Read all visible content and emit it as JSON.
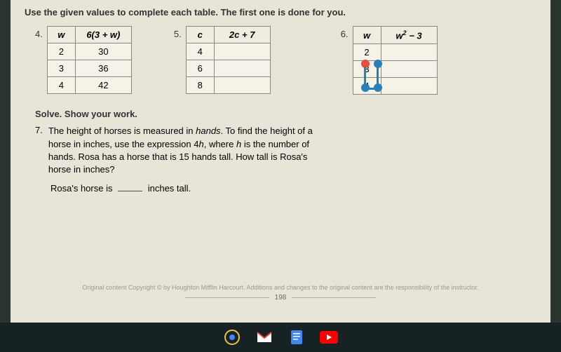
{
  "instruction": "Use the given values to complete each table. The first one is done for you.",
  "tables": [
    {
      "num": "4.",
      "col1_header": "w",
      "col2_header": "6(3 + w)",
      "rows": [
        {
          "c1": "2",
          "c2": "30"
        },
        {
          "c1": "3",
          "c2": "36"
        },
        {
          "c1": "4",
          "c2": "42"
        }
      ]
    },
    {
      "num": "5.",
      "col1_header": "c",
      "col2_header": "2c + 7",
      "rows": [
        {
          "c1": "4",
          "c2": ""
        },
        {
          "c1": "6",
          "c2": ""
        },
        {
          "c1": "8",
          "c2": ""
        }
      ]
    },
    {
      "num": "6.",
      "col1_header": "w",
      "col2_header_html": "w² − 3",
      "rows": [
        {
          "c1": "2",
          "c2": ""
        },
        {
          "c1": "3",
          "c2": ""
        },
        {
          "c1": "4",
          "c2": ""
        }
      ]
    }
  ],
  "solve_header": "Solve. Show your work.",
  "problem7": {
    "num": "7.",
    "text_parts": {
      "p1": "The height of horses is measured in ",
      "italic1": "hands",
      "p2": ". To find the height of a horse in inches, use the expression 4",
      "italic2": "h",
      "p3": ", where ",
      "italic3": "h",
      "p4": " is the number of hands. Rosa has a horse that is 15 hands tall. How tall is Rosa's horse in inches?"
    },
    "answer_prefix": "Rosa's horse is",
    "answer_suffix": "inches tall."
  },
  "copyright": "Original content Copyright © by Houghton Mifflin Harcourt. Additions and changes to the original content are the responsibility of the instructor.",
  "page_number": "198"
}
